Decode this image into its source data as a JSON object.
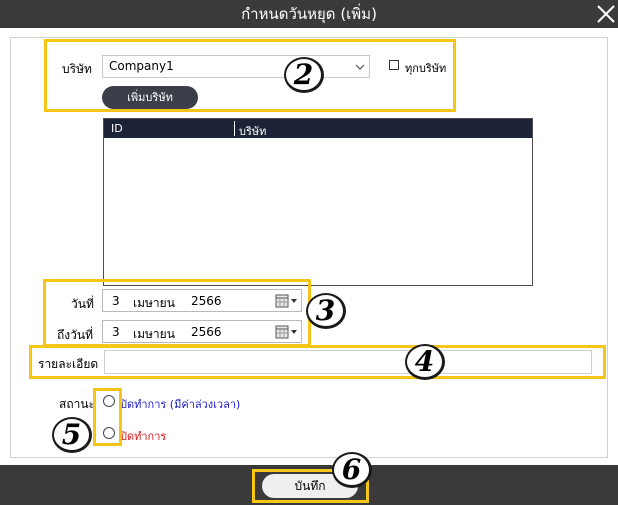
{
  "window": {
    "title": "กำหนดวันหยุด (เพิ่ม)"
  },
  "company": {
    "label": "บริษัท",
    "selected": "Company1",
    "all_companies_label": "ทุกบริษัท",
    "add_button": "เพิ่มบริษัท"
  },
  "grid": {
    "columns": [
      "ID",
      "บริษัท"
    ],
    "rows": []
  },
  "dates": {
    "from": {
      "label": "วันที่",
      "day": "3",
      "month": "เมษายน",
      "year": "2566"
    },
    "to": {
      "label": "ถึงวันที่",
      "day": "3",
      "month": "เมษายน",
      "year": "2566"
    }
  },
  "detail": {
    "label": "รายละเอียด",
    "value": ""
  },
  "status": {
    "label": "สถานะ",
    "options": [
      {
        "label": "ปิดทำการ (มีค่าล่วงเวลา)",
        "color": "#1a1ad0",
        "selected": false
      },
      {
        "label": "ปิดทำการ",
        "color": "#d01818",
        "selected": false
      }
    ]
  },
  "footer": {
    "save_label": "บันทึก"
  },
  "callouts": [
    "2",
    "3",
    "4",
    "5",
    "6"
  ],
  "colors": {
    "highlight": "#f5c518",
    "titlebar": "#3a3a3a",
    "grid_header": "#1c2336"
  }
}
